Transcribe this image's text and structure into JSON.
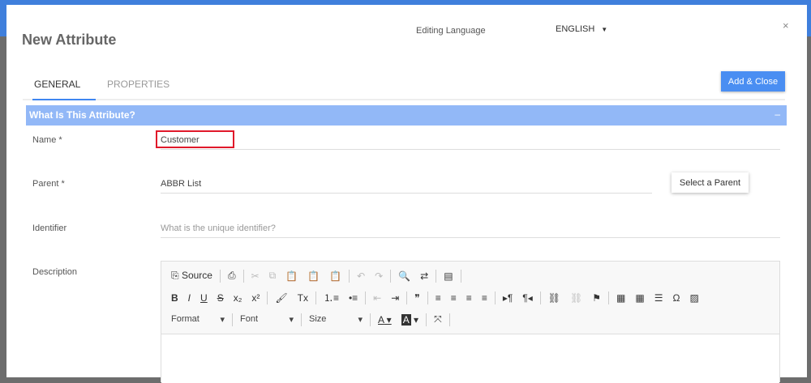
{
  "dialog": {
    "title": "New Attribute",
    "editing_language_label": "Editing Language",
    "language": "ENGLISH",
    "close": "×",
    "add_close": "Add & Close"
  },
  "tabs": [
    {
      "label": "GENERAL"
    },
    {
      "label": "PROPERTIES"
    }
  ],
  "section": {
    "title": "What Is This Attribute?",
    "collapse": "–"
  },
  "fields": {
    "name": {
      "label": "Name *",
      "value": "Customer"
    },
    "parent": {
      "label": "Parent  *",
      "value": "ABBR List",
      "button": "Select a Parent"
    },
    "identifier": {
      "label": "Identifier",
      "placeholder": "What is the unique identifier?"
    },
    "description": {
      "label": "Description"
    }
  },
  "toolbar": {
    "source": "Source",
    "row1": [
      "⎙",
      "✂",
      "⧉",
      "📋",
      "📋",
      "📋",
      "↶",
      "↷",
      "🔍",
      "⇄",
      "▤"
    ],
    "row2": [
      "B",
      "I",
      "U",
      "S",
      "x₂",
      "x²",
      "🖌",
      "Tx",
      "⒈≡",
      "•≡",
      "⇤",
      "⇥",
      "❞",
      "≡",
      "≡",
      "≡",
      "≡",
      "▸¶",
      "¶◂",
      "⛓",
      "⛓",
      "⚑",
      "▦",
      "▦",
      "☰",
      "Ω",
      "▨"
    ],
    "format": "Format",
    "font": "Font",
    "size": "Size",
    "text_color": "A",
    "bg_color": "A",
    "maximize": "⤧",
    "caret": "▾"
  }
}
